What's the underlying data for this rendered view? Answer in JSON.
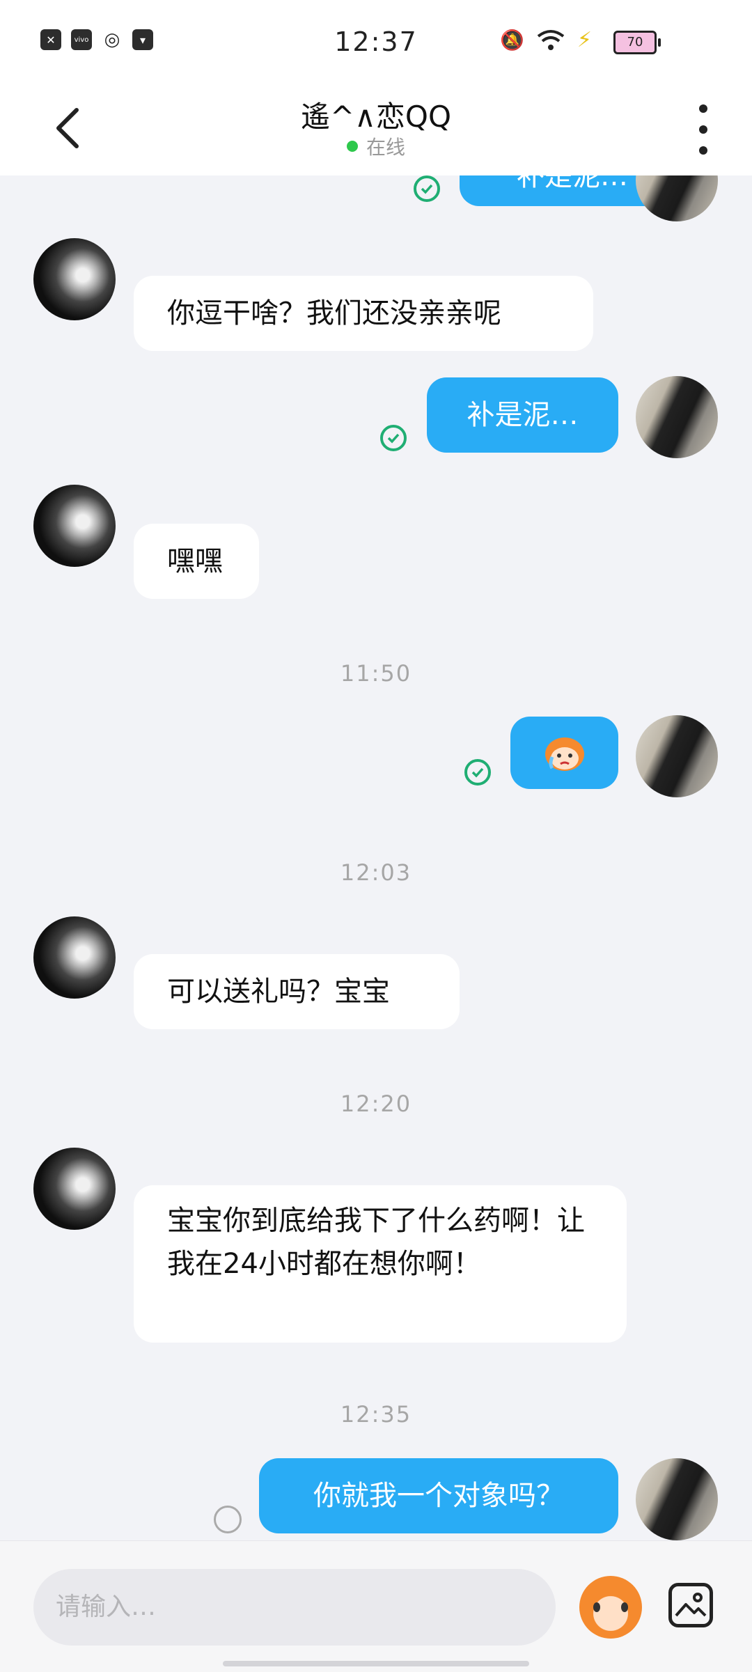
{
  "status_bar": {
    "time": "12:37",
    "battery": "70"
  },
  "header": {
    "title": "遙^∧恋QQ",
    "status": "在线"
  },
  "messages": {
    "m0": {
      "text": "补是泥…"
    },
    "m1": {
      "text": "你逗干啥？我们还没亲亲呢"
    },
    "m2": {
      "text": "补是泥…"
    },
    "m3": {
      "text": "嘿嘿"
    },
    "t1": "11:50",
    "t2": "12:03",
    "m5": {
      "text": "可以送礼吗？宝宝"
    },
    "t3": "12:20",
    "m6": {
      "text": "宝宝你到底给我下了什么药啊！让我在24小时都在想你啊！"
    },
    "t4": "12:35",
    "m7": {
      "text": "你就我一个对象吗？"
    }
  },
  "input": {
    "placeholder": "请输入…"
  },
  "colors": {
    "outgoing_bubble": "#29acf5",
    "incoming_bubble": "#ffffff",
    "read_check": "#1fae73",
    "online_dot": "#2ec84c"
  }
}
